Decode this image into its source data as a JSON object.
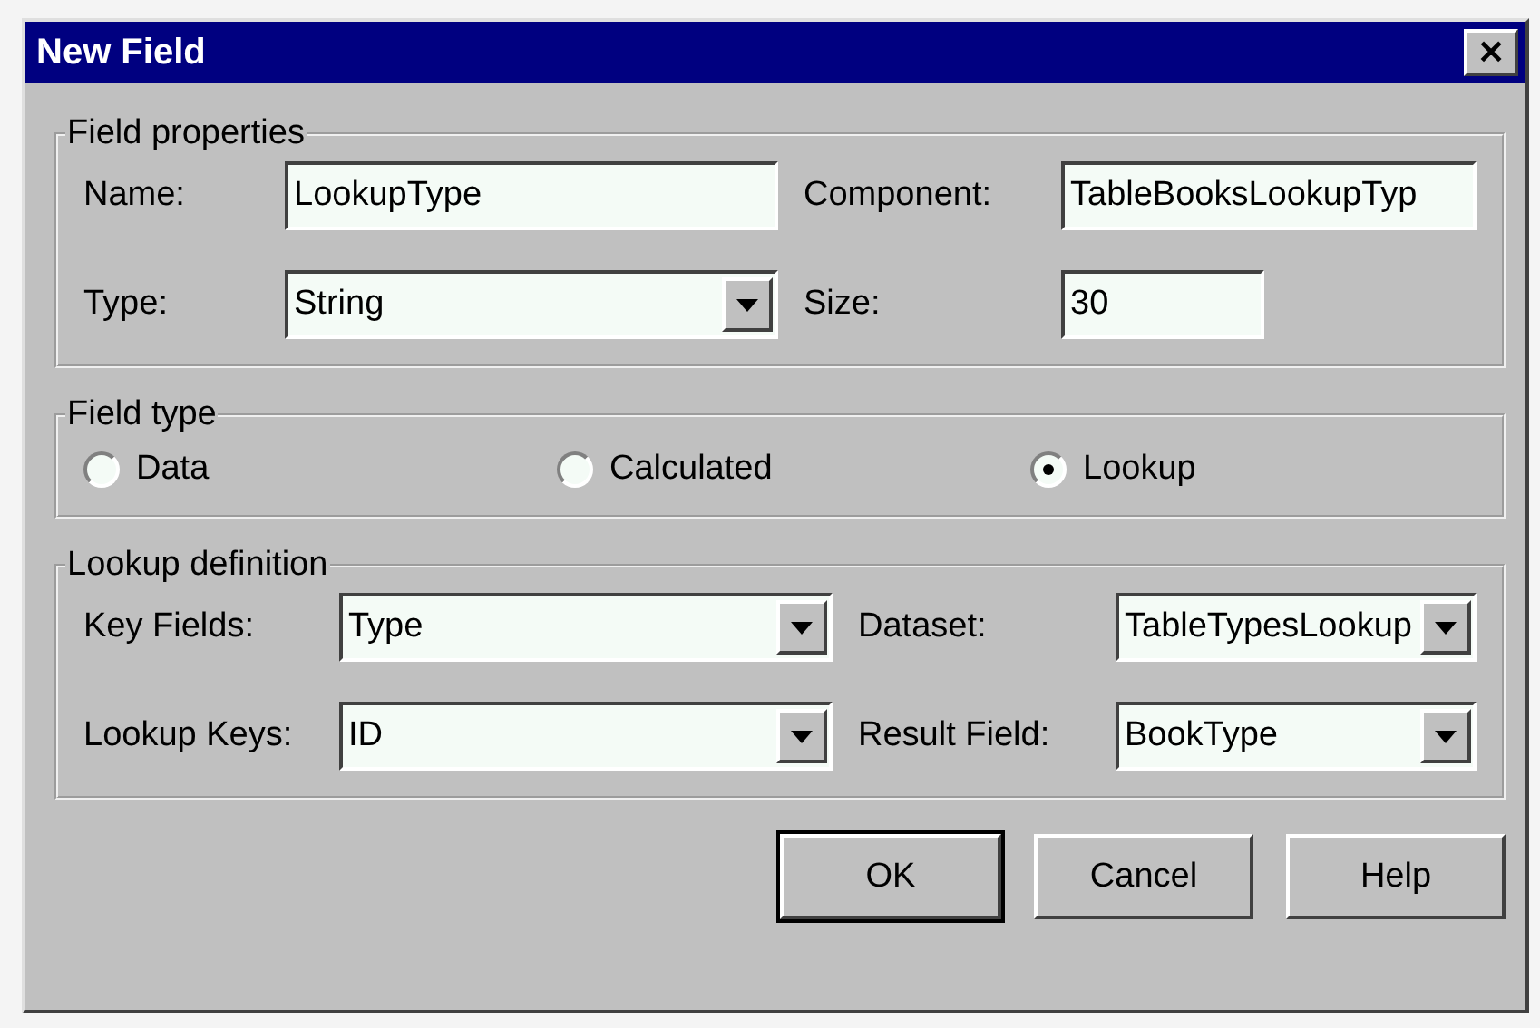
{
  "window": {
    "title": "New Field",
    "close": "✕"
  },
  "field_properties": {
    "title": "Field properties",
    "fields": [
      {
        "label": "Name:",
        "kind": "text",
        "value": "LookupType"
      },
      {
        "label": "Component:",
        "kind": "text",
        "value": "TableBooksLookupTyp"
      },
      {
        "label": "Type:",
        "kind": "select",
        "value": "String"
      },
      {
        "label": "Size:",
        "kind": "short",
        "value": "30"
      }
    ]
  },
  "field_type": {
    "title": "Field type",
    "options": [
      {
        "label": "Data",
        "selected": false
      },
      {
        "label": "Calculated",
        "selected": false
      },
      {
        "label": "Lookup",
        "selected": true
      }
    ]
  },
  "lookup_definition": {
    "title": "Lookup definition",
    "fields": [
      {
        "label": "Key Fields:",
        "kind": "select",
        "value": "Type"
      },
      {
        "label": "Dataset:",
        "kind": "select",
        "value": "TableTypesLookup"
      },
      {
        "label": "Lookup Keys:",
        "kind": "select",
        "value": "ID"
      },
      {
        "label": "Result Field:",
        "kind": "select",
        "value": "BookType"
      }
    ]
  },
  "buttons": [
    {
      "label": "OK",
      "default": true
    },
    {
      "label": "Cancel",
      "default": false
    },
    {
      "label": "Help",
      "default": false
    }
  ]
}
